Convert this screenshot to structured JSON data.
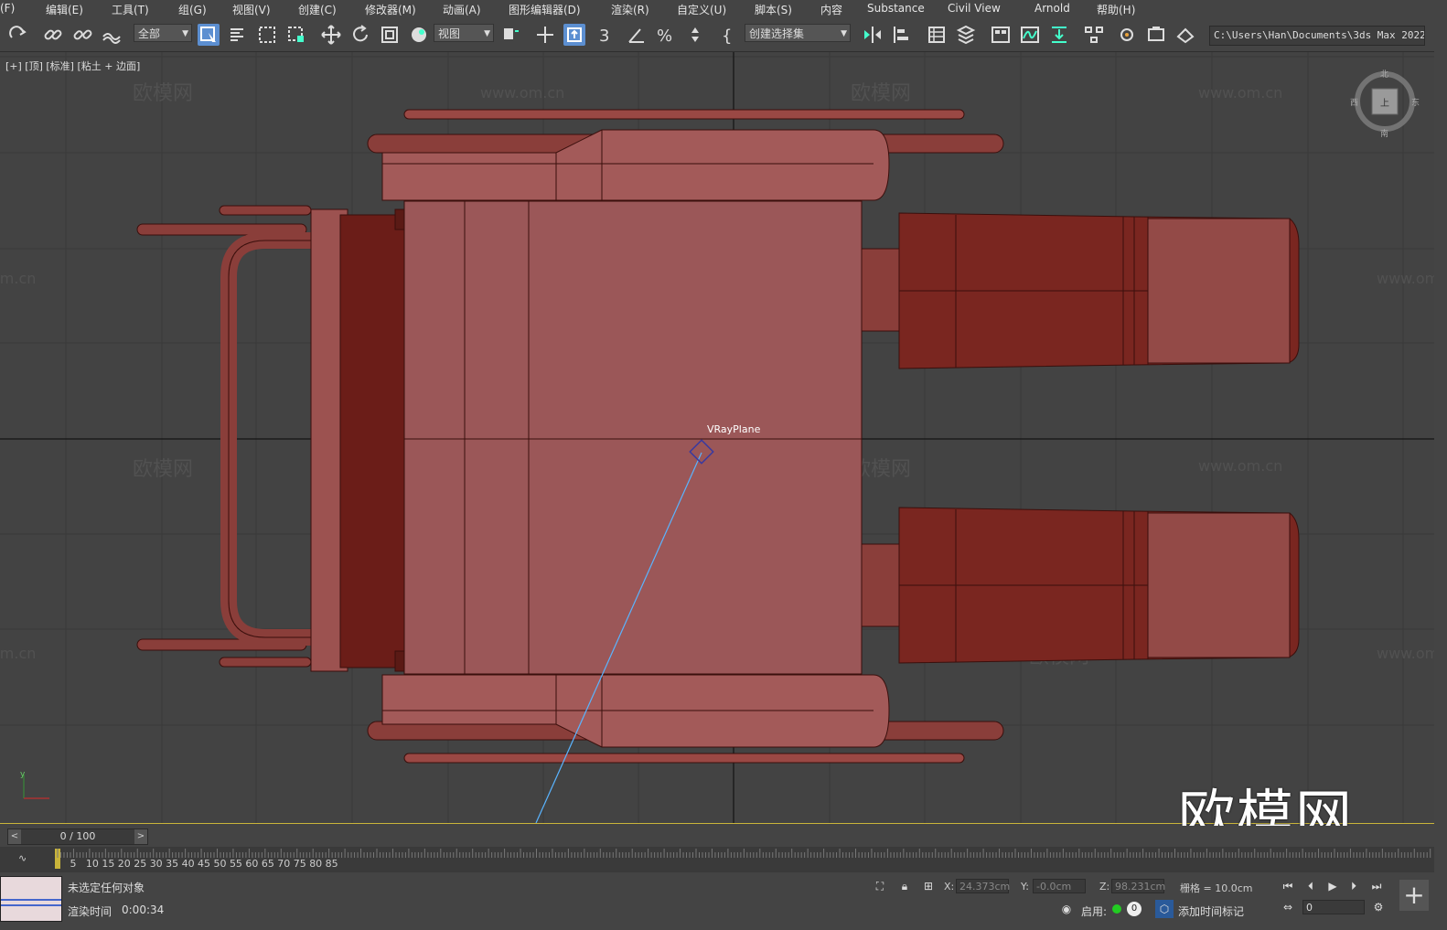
{
  "menu": [
    "(F)",
    "编辑(E)",
    "工具(T)",
    "组(G)",
    "视图(V)",
    "创建(C)",
    "修改器(M)",
    "动画(A)",
    "图形编辑器(D)",
    "渲染(R)",
    "自定义(U)",
    "脚本(S)",
    "内容",
    "Substance",
    "Civil View",
    "Arnold",
    "帮助(H)"
  ],
  "toolbar": {
    "filter_dropdown": "全部",
    "refcoord_dropdown": "视图",
    "selection_set_dropdown": "创建选择集",
    "project_path": "C:\\Users\\Han\\Documents\\3ds Max 2022"
  },
  "viewport": {
    "label": "[+] [顶] [标准] [粘土 + 边面]",
    "object_label": "VRayPlane",
    "viewcube": {
      "north": "北",
      "south": "南",
      "east": "东",
      "west": "西",
      "face": "上"
    },
    "watermark_small_cn": "欧模网",
    "watermark_small_url": "www.om.cn",
    "watermark_big": "欧模网"
  },
  "timeline": {
    "frame_display": "0 / 100",
    "ticks": [
      "5",
      "10",
      "15",
      "20",
      "25",
      "30",
      "35",
      "40",
      "45",
      "50",
      "55",
      "60",
      "65",
      "70",
      "75",
      "80",
      "85"
    ]
  },
  "status": {
    "selection_msg": "未选定任何对象",
    "render_time_label": "渲染时间",
    "render_time_value": "0:00:34",
    "x_label": "X:",
    "x_value": "24.373cm",
    "y_label": "Y:",
    "y_value": "-0.0cm",
    "z_label": "Z:",
    "z_value": "98.231cm",
    "grid": "栅格 = 10.0cm",
    "enable_label": "启用:",
    "enable_count": "0",
    "add_time_tag": "添加时间标记",
    "frame_field": "0"
  },
  "colors": {
    "model": "#8b4443",
    "model_dark": "#5a1f1a",
    "accent": "#5c8fd1",
    "timeline_marker": "#c9b43a"
  }
}
